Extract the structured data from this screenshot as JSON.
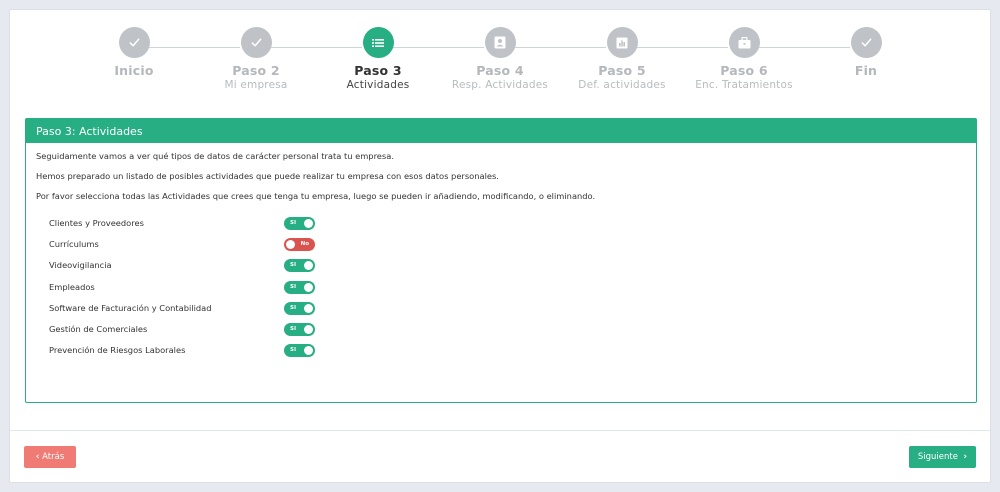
{
  "stepper": {
    "steps": [
      {
        "title": "Inicio",
        "subtitle": "",
        "state": "done",
        "icon": "check-icon"
      },
      {
        "title": "Paso 2",
        "subtitle": "Mi empresa",
        "state": "done",
        "icon": "check-icon"
      },
      {
        "title": "Paso 3",
        "subtitle": "Actividades",
        "state": "active",
        "icon": "list-icon"
      },
      {
        "title": "Paso 4",
        "subtitle": "Resp. Actividades",
        "state": "pending",
        "icon": "id-card-icon"
      },
      {
        "title": "Paso 5",
        "subtitle": "Def. actividades",
        "state": "pending",
        "icon": "chart-icon"
      },
      {
        "title": "Paso 6",
        "subtitle": "Enc. Tratamientos",
        "state": "pending",
        "icon": "briefcase-icon"
      },
      {
        "title": "Fin",
        "subtitle": "",
        "state": "pending",
        "icon": "check-icon"
      }
    ]
  },
  "panel": {
    "title": "Paso 3: Actividades",
    "paragraphs": [
      "Seguidamente vamos a ver qué tipos de datos de carácter personal trata tu empresa.",
      "Hemos preparado un listado de posibles actividades que puede realizar tu empresa con esos datos personales.",
      "Por favor selecciona todas las Actividades que crees que tenga tu empresa, luego se pueden ir añadiendo, modificando, o eliminando."
    ],
    "activities": [
      {
        "label": "Clientes y Proveedores",
        "enabled": true,
        "toggle_text": "SI"
      },
      {
        "label": "Currículums",
        "enabled": false,
        "toggle_text": "No"
      },
      {
        "label": "Videovigilancia",
        "enabled": true,
        "toggle_text": "SI"
      },
      {
        "label": "Empleados",
        "enabled": true,
        "toggle_text": "SI"
      },
      {
        "label": "Software de Facturación y Contabilidad",
        "enabled": true,
        "toggle_text": "SI"
      },
      {
        "label": "Gestión de Comerciales",
        "enabled": true,
        "toggle_text": "SI"
      },
      {
        "label": "Prevención de Riesgos Laborales",
        "enabled": true,
        "toggle_text": "SI"
      }
    ]
  },
  "footer": {
    "back_label": "Atrás",
    "next_label": "Siguiente"
  },
  "colors": {
    "accent": "#27ae82",
    "danger": "#d9534f",
    "back_button": "#f07b74",
    "step_inactive": "#bfc2c6"
  }
}
